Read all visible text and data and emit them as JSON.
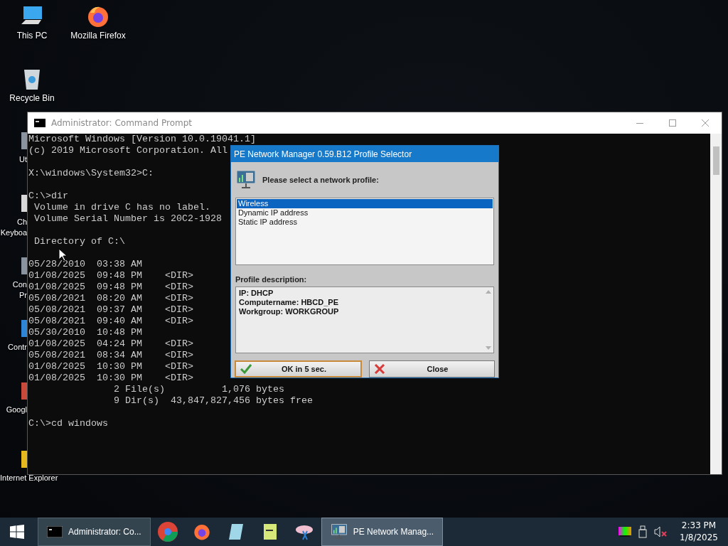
{
  "desktop_icons": [
    {
      "kind": "pc",
      "lines": [
        "This PC"
      ],
      "partial": false
    },
    {
      "kind": "recycle",
      "lines": [
        "Recycle Bin"
      ],
      "partial": false
    },
    {
      "kind": "folder",
      "lines": [
        "Ut"
      ],
      "partial": true
    },
    {
      "kind": "keyboard",
      "lines": [
        "Ch",
        "Keyboa"
      ],
      "partial": true
    },
    {
      "kind": "folder",
      "lines": [
        "Con",
        "Pr"
      ],
      "partial": true
    },
    {
      "kind": "control",
      "lines": [
        "Contr"
      ],
      "partial": true
    },
    {
      "kind": "chrome",
      "lines": [
        "Googl"
      ],
      "partial": true
    },
    {
      "kind": "ie",
      "lines": [
        "Internet Explorer"
      ],
      "partial": true
    }
  ],
  "desktop_icons_column_2": [
    {
      "kind": "firefox",
      "lines": [
        "Mozilla Firefox"
      ],
      "partial": false
    }
  ],
  "console_window": {
    "title": "Administrator: Command Prompt",
    "blocks": [
      [
        "Microsoft Windows [Version 10.0.19041.1]",
        "(c) 2019 Microsoft Corporation. All"
      ],
      [
        "X:\\windows\\System32>C:"
      ],
      [
        "C:\\>dir",
        " Volume in drive C has no label.",
        " Volume Serial Number is 20C2-1928"
      ],
      [
        " Directory of C:\\"
      ],
      [
        "05/28/2010  03:38 AM",
        "01/08/2025  09:48 PM    <DIR>",
        "01/08/2025  09:48 PM    <DIR>",
        "05/08/2021  08:20 AM    <DIR>",
        "05/08/2021  09:37 AM    <DIR>",
        "05/08/2021  09:40 AM    <DIR>",
        "05/30/2010  10:48 PM",
        "01/08/2025  04:24 PM    <DIR>",
        "05/08/2021  08:34 AM    <DIR>",
        "01/08/2025  10:30 PM    <DIR>",
        "01/08/2025  10:30 PM    <DIR>",
        "               2 File(s)          1,076 bytes",
        "               9 Dir(s)  43,847,827,456 bytes free"
      ],
      [
        "C:\\>cd windows"
      ]
    ]
  },
  "dialog": {
    "title": "PE Network Manager 0.59.B12 Profile Selector",
    "prompt": "Please select a network profile:",
    "profiles": [
      {
        "label": "Wireless",
        "selected": true
      },
      {
        "label": "Dynamic IP address",
        "selected": false
      },
      {
        "label": "Static IP address",
        "selected": false
      }
    ],
    "description_label": "Profile description:",
    "description_lines": [
      "IP: DHCP",
      "Computername: HBCD_PE",
      "Workgroup: WORKGROUP"
    ],
    "buttons": [
      {
        "kind": "ok",
        "label": "OK in 5 sec.",
        "focused": true
      },
      {
        "kind": "close",
        "label": "Close",
        "focused": false
      }
    ]
  },
  "taskbar": {
    "items": [
      {
        "kind": "cmd",
        "label": "Administrator: Co...",
        "selected": false
      },
      {
        "kind": "chrome",
        "selected": false
      },
      {
        "kind": "firefox",
        "selected": false
      },
      {
        "kind": "notepad",
        "selected": false
      },
      {
        "kind": "editor",
        "selected": false
      },
      {
        "kind": "tool",
        "selected": false
      },
      {
        "kind": "network",
        "label": "PE Network Manag...",
        "selected": true
      }
    ],
    "clock": {
      "time": "2:33 PM",
      "date": "1/8/2025"
    }
  }
}
